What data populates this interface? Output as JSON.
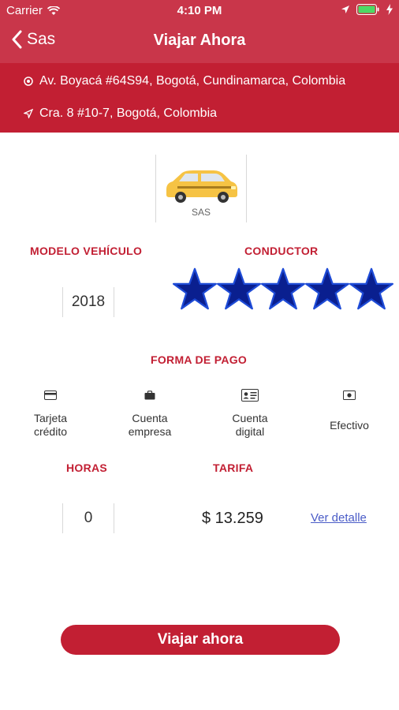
{
  "status_bar": {
    "carrier": "Carrier",
    "time": "4:10 PM"
  },
  "nav": {
    "back_label": "Sas",
    "title": "Viajar Ahora"
  },
  "addresses": {
    "origin": "Av. Boyacá #64S94, Bogotá, Cundinamarca, Colombia",
    "destination": "Cra. 8 #10-7, Bogotá, Colombia"
  },
  "vehicle": {
    "label": "SAS",
    "icon": "taxi-car-icon"
  },
  "labels": {
    "model": "MODELO VEHÍCULO",
    "driver": "CONDUCTOR",
    "payment": "FORMA DE PAGO",
    "hours": "HORAS",
    "fare": "TARIFA"
  },
  "model_year": "2018",
  "driver_rating": {
    "value": 5,
    "max": 5
  },
  "payment_methods": [
    {
      "icon": "credit-card-icon",
      "line1": "Tarjeta",
      "line2": "crédito"
    },
    {
      "icon": "briefcase-icon",
      "line1": "Cuenta",
      "line2": "empresa"
    },
    {
      "icon": "id-card-icon",
      "line1": "Cuenta",
      "line2": "digital"
    },
    {
      "icon": "cash-icon",
      "line1": "Efectivo",
      "line2": ""
    }
  ],
  "hours_value": "0",
  "fare_value": "$ 13.259",
  "detail_link": "Ver detalle",
  "cta_label": "Viajar ahora",
  "colors": {
    "nav": "#c9364a",
    "accent": "#c21f33",
    "star": "#0a1f8f",
    "link": "#4a5cc7"
  }
}
